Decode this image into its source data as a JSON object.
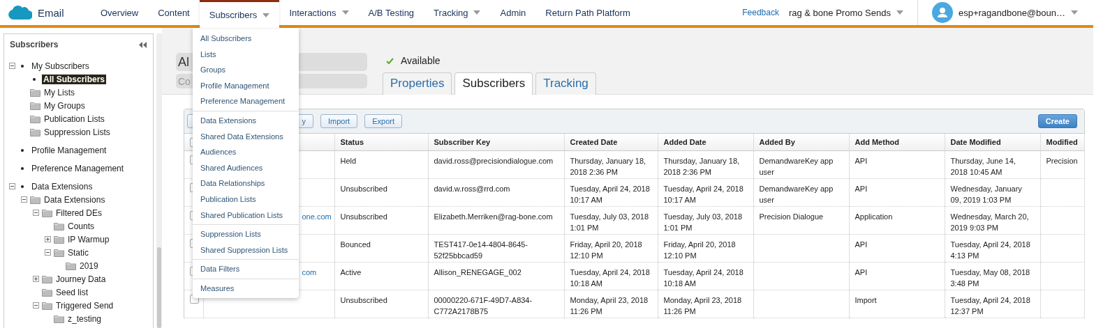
{
  "app_bar": {
    "product": "Email",
    "nav": [
      {
        "label": "Overview",
        "selected": false,
        "has_menu": false
      },
      {
        "label": "Content",
        "selected": false,
        "has_menu": false
      },
      {
        "label": "Subscribers",
        "selected": true,
        "has_menu": true
      },
      {
        "label": "Interactions",
        "selected": false,
        "has_menu": true
      },
      {
        "label": "A/B Testing",
        "selected": false,
        "has_menu": false
      },
      {
        "label": "Tracking",
        "selected": false,
        "has_menu": true
      },
      {
        "label": "Admin",
        "selected": false,
        "has_menu": false
      },
      {
        "label": "Return Path Platform",
        "selected": false,
        "has_menu": false
      }
    ],
    "feedback": "Feedback",
    "business_unit": "rag & bone Promo Sends",
    "user": "esp+ragandbone@boun…"
  },
  "nav_menu": {
    "groups": [
      [
        "All Subscribers",
        "Lists",
        "Groups",
        "Profile Management",
        "Preference Management"
      ],
      [
        "Data Extensions",
        "Shared Data Extensions",
        "Audiences",
        "Shared Audiences",
        "Data Relationships",
        "Publication Lists",
        "Shared Publication Lists"
      ],
      [
        "Suppression Lists",
        "Shared Suppression Lists"
      ],
      [
        "Data Filters"
      ],
      [
        "Measures"
      ]
    ]
  },
  "sidebar": {
    "title": "Subscribers",
    "items": [
      {
        "label": "My Subscribers",
        "kind": "bullet",
        "selected": false,
        "expanded": true,
        "children": [
          {
            "label": "All Subscribers",
            "kind": "bullet",
            "selected": true
          },
          {
            "label": "My Lists",
            "kind": "folder",
            "selected": false
          },
          {
            "label": "My Groups",
            "kind": "folder",
            "selected": false
          },
          {
            "label": "Publication Lists",
            "kind": "folder",
            "selected": false
          },
          {
            "label": "Suppression Lists",
            "kind": "folder",
            "selected": false
          }
        ]
      },
      {
        "label": "Profile Management",
        "kind": "bullet",
        "selected": false
      },
      {
        "label": "Preference Management",
        "kind": "bullet",
        "selected": false
      },
      {
        "label": "Data Extensions",
        "kind": "bullet",
        "selected": false,
        "expanded": true,
        "children": [
          {
            "label": "Data Extensions",
            "kind": "folder",
            "selected": false,
            "expanded": true,
            "children": [
              {
                "label": "Filtered DEs",
                "kind": "folder",
                "selected": false,
                "expanded": true,
                "children": [
                  {
                    "label": "Counts",
                    "kind": "folder",
                    "selected": false
                  },
                  {
                    "label": "IP Warmup",
                    "kind": "folder",
                    "selected": false,
                    "expanded": false
                  },
                  {
                    "label": "Static",
                    "kind": "folder",
                    "selected": false,
                    "expanded": true,
                    "children": [
                      {
                        "label": "2019",
                        "kind": "folder",
                        "selected": false
                      }
                    ]
                  }
                ]
              },
              {
                "label": "Journey Data",
                "kind": "folder",
                "selected": false,
                "expanded": false
              },
              {
                "label": "Seed list",
                "kind": "folder",
                "selected": false
              },
              {
                "label": "Triggered Send",
                "kind": "folder",
                "selected": false,
                "expanded": true,
                "children": [
                  {
                    "label": "z_testing",
                    "kind": "folder",
                    "selected": false
                  }
                ]
              }
            ]
          }
        ]
      }
    ]
  },
  "detail": {
    "name": "Al",
    "description_placeholder": "Co",
    "status": "Available",
    "tabs": [
      {
        "label": "Properties",
        "selected": false
      },
      {
        "label": "Subscribers",
        "selected": true
      },
      {
        "label": "Tracking",
        "selected": false
      }
    ]
  },
  "toolbar": {
    "buttons": [
      "y",
      "Import",
      "Export"
    ],
    "create": "Create"
  },
  "table": {
    "select_all_checked": false,
    "columns": [
      null,
      "Status",
      "Subscriber Key",
      "Created Date",
      "Added Date",
      "Added By",
      "Add Method",
      "Date Modified",
      "Modified"
    ],
    "rows": [
      {
        "checked": false,
        "cells": [
          null,
          "Held",
          "david.ross@precisiondialogue.com",
          "Thursday, January 18, 2018 2:36 PM",
          "Thursday, January 18, 2018 2:36 PM",
          "DemandwareKey app user",
          "API",
          "Thursday, June 14, 2018 10:45 AM",
          "Precision"
        ]
      },
      {
        "checked": false,
        "cells": [
          null,
          "Unsubscribed",
          "david.w.ross@rrd.com",
          "Tuesday, April 24, 2018 10:17 AM",
          "Tuesday, April 24, 2018 10:17 AM",
          "DemandwareKey app user",
          "API",
          "Wednesday, January 09, 2019 1:03 PM",
          null
        ]
      },
      {
        "checked": false,
        "cells": [
          "one.com",
          "Unsubscribed",
          "Elizabeth.Merriken@rag-bone.com",
          "Tuesday, July 03, 2018 1:01 PM",
          "Tuesday, July 03, 2018 1:01 PM",
          "Precision Dialogue",
          "Application",
          "Wednesday, March 20, 2019 9:03 PM",
          null
        ]
      },
      {
        "checked": false,
        "cells": [
          null,
          "Bounced",
          "TEST417-0e14-4804-8645-52f25bbcad59",
          "Friday, April 20, 2018 12:10 PM",
          "Friday, April 20, 2018 12:10 PM",
          null,
          "API",
          "Tuesday, April 24, 2018 4:13 PM",
          null
        ]
      },
      {
        "checked": false,
        "cells": [
          "com",
          "Active",
          "Allison_RENEGAGE_002",
          "Tuesday, April 24, 2018 10:18 AM",
          "Tuesday, April 24, 2018 10:18 AM",
          null,
          "API",
          "Tuesday, May 08, 2018 3:48 PM",
          null
        ]
      },
      {
        "checked": false,
        "cells": [
          null,
          "Unsubscribed",
          "00000220-671F-49D7-A834-C772A2178B75",
          "Monday, April 23, 2018 11:26 PM",
          "Monday, April 23, 2018 11:26 PM",
          null,
          "Import",
          "Tuesday, April 24, 2018 12:37 PM",
          null
        ]
      }
    ]
  }
}
